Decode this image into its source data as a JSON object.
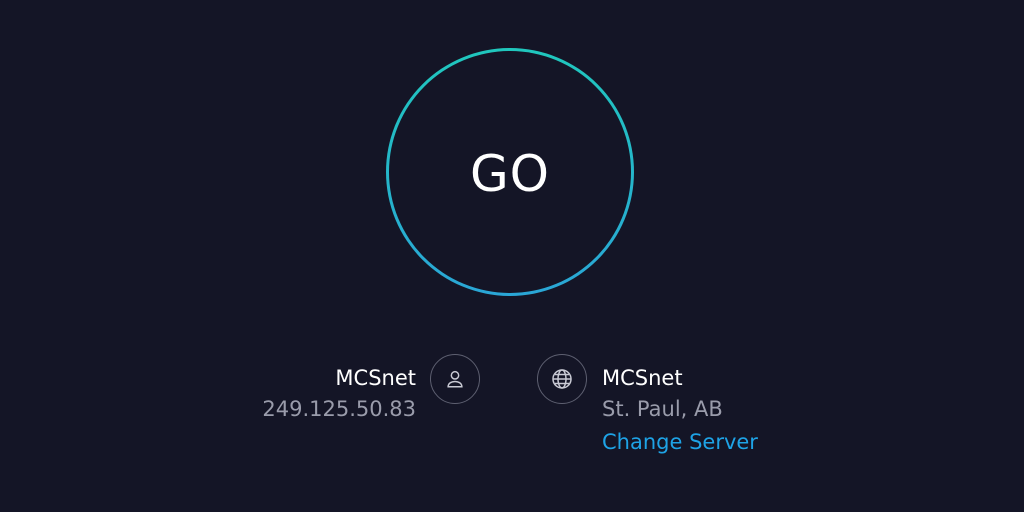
{
  "go_button": {
    "label": "GO"
  },
  "provider": {
    "name": "MCSnet",
    "ip": "249.125.50.83",
    "icon": "user-icon"
  },
  "server": {
    "name": "MCSnet",
    "location": "St. Paul, AB",
    "change_label": "Change Server",
    "icon": "globe-icon"
  },
  "colors": {
    "background": "#141526",
    "ring_top": "#20c7bd",
    "ring_bottom": "#2aa6d6",
    "link": "#1ea3e6",
    "muted_text": "#9a9cab"
  }
}
